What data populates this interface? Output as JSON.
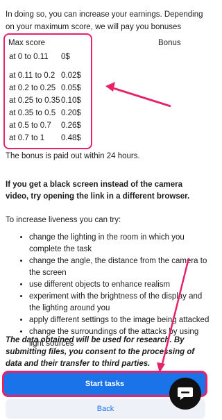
{
  "intro": "In doing so, you can increase your earnings. Depending on your maximum score, we will pay you bonuses",
  "table": {
    "col_score": "Max score",
    "col_bonus": "Bonus",
    "rows": [
      {
        "range": "at 0 to 0.11",
        "bonus": "0$"
      },
      {
        "range": "at 0.11 to 0.2",
        "bonus": "0.02$"
      },
      {
        "range": "at 0.2 to 0.25",
        "bonus": "0.05$"
      },
      {
        "range": "at 0.25 to 0.35",
        "bonus": "0.10$"
      },
      {
        "range": "at 0.35 to 0.5",
        "bonus": "0.20$"
      },
      {
        "range": "at 0.5 to 0.7",
        "bonus": "0.26$"
      },
      {
        "range": "at 0.7 to 1",
        "bonus": "0.48$"
      }
    ]
  },
  "bonus_note": "The bonus is paid out within 24 hours.",
  "black_screen_tip": "If you get a black screen instead of the camera video, try opening the link in a different browser.",
  "liveness_intro": "To increase liveness you can try:",
  "tips": [
    "change the lighting in the room in which you complete the task",
    "change the angle, the distance from the camera to the screen",
    "use different objects to enhance realism",
    "experiment with the brightness of the display and the lighting around you",
    "apply different settings to the image being attacked",
    "change the surroundings of the attacks by using light sources"
  ],
  "disclaimer": "The data obtained will be used for research. By submitting files, you consent to the processing of data and their transfer to third parties.",
  "buttons": {
    "start": "Start tasks",
    "back": "Back"
  },
  "colors": {
    "accent": "#1a73e8",
    "highlight": "#e6226a"
  },
  "icons": {
    "chat": "chat-bubble-icon"
  }
}
